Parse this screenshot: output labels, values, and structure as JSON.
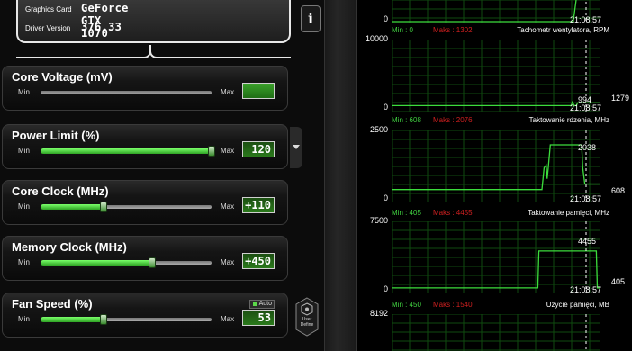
{
  "gpu_info": {
    "graphics_card_label": "Graphics Card",
    "graphics_card_value": "GeForce GTX 1070",
    "driver_label": "Driver Version",
    "driver_value": "376.33",
    "info_button": "i"
  },
  "sliders": [
    {
      "title": "Core Voltage (mV)",
      "min_label": "Min",
      "max_label": "Max",
      "value": "",
      "level": 0.0
    },
    {
      "title": "Power Limit (%)",
      "min_label": "Min",
      "max_label": "Max",
      "value": "120",
      "level": 1.0
    },
    {
      "title": "Core Clock (MHz)",
      "min_label": "Min",
      "max_label": "Max",
      "value": "+110",
      "level": 0.37
    },
    {
      "title": "Memory Clock (MHz)",
      "min_label": "Min",
      "max_label": "Max",
      "value": "+450",
      "level": 0.65
    },
    {
      "title": "Fan Speed (%)",
      "min_label": "Min",
      "max_label": "Max",
      "value": "53",
      "level": 0.37
    }
  ],
  "fan_auto_label": "Auto",
  "user_define_label": [
    "User",
    "Define"
  ],
  "graphs": [
    {
      "name": "Tachometr wentylatora, RPM",
      "top": "",
      "zero": "0",
      "min_text": "Min : 0",
      "max_text": "Maks : 1302",
      "current": "",
      "time": "21:08:57",
      "right_value": "",
      "max_value": 1302,
      "series": [
        [
          0,
          0
        ],
        [
          0.87,
          0
        ],
        [
          0.905,
          1302
        ]
      ]
    },
    {
      "name": "Taktowanie rdzenia, MHz",
      "top": "10000",
      "zero": "0",
      "min_text": "Min : 608",
      "max_text": "Maks : 2076",
      "current": "994",
      "time": "21:08:57",
      "right_value": "1279",
      "max_value": 10000,
      "series": [
        [
          0,
          608
        ],
        [
          0.86,
          608
        ],
        [
          0.865,
          1100
        ],
        [
          0.875,
          608
        ],
        [
          0.885,
          608
        ],
        [
          0.89,
          994
        ],
        [
          1,
          994
        ]
      ]
    },
    {
      "name": "Taktowanie pamięci, MHz",
      "top": "2500",
      "zero": "0",
      "min_text": "Min : 405",
      "max_text": "Maks : 4455",
      "current": "2038",
      "time": "21:08:57",
      "right_value": "608",
      "max_value": 2500,
      "series": [
        [
          0,
          405
        ],
        [
          0.72,
          405
        ],
        [
          0.73,
          1200
        ],
        [
          0.74,
          1300
        ],
        [
          0.745,
          800
        ],
        [
          0.75,
          1200
        ],
        [
          0.76,
          2038
        ],
        [
          0.91,
          2038
        ],
        [
          0.915,
          1200
        ],
        [
          0.925,
          608
        ],
        [
          1,
          608
        ]
      ]
    },
    {
      "name": "Użycie pamięci, MB",
      "top": "7500",
      "zero": "0",
      "min_text": "Min : 450",
      "max_text": "Maks : 1540",
      "current": "4455",
      "time": "21:08:57",
      "right_value": "405",
      "max_value": 7500,
      "series": [
        [
          0,
          405
        ],
        [
          0.7,
          405
        ],
        [
          0.705,
          4455
        ],
        [
          0.98,
          4455
        ],
        [
          0.985,
          405
        ],
        [
          1,
          405
        ]
      ]
    },
    {
      "name": "",
      "top": "8192",
      "zero": "",
      "min_text": "",
      "max_text": "",
      "current": "",
      "time": "",
      "right_value": "",
      "max_value": 8192,
      "series": [
        [
          0,
          0
        ]
      ]
    }
  ],
  "colors": {
    "accent_green": "#3cdc3c",
    "grid_green": "#0f4a0f",
    "max_red": "#d02020"
  }
}
